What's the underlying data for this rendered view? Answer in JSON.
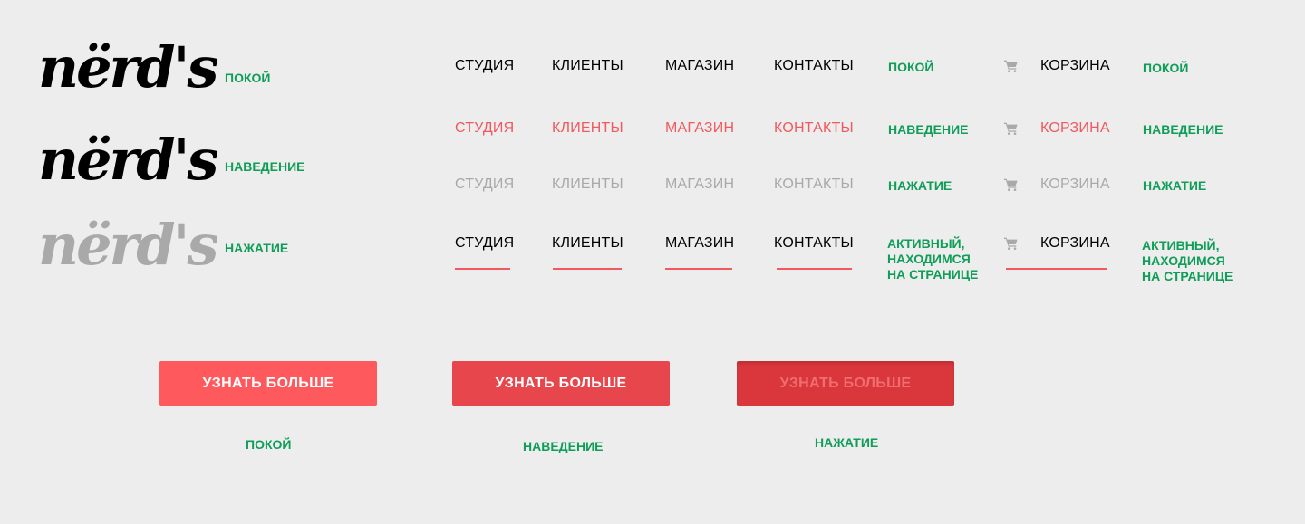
{
  "logo": {
    "text": "nërd's"
  },
  "logo_states": [
    "ПОКОЙ",
    "НАВЕДЕНИЕ",
    "НАЖАТИЕ"
  ],
  "nav": {
    "items": [
      "СТУДИЯ",
      "КЛИЕНТЫ",
      "МАГАЗИН",
      "КОНТАКТЫ"
    ],
    "cart": {
      "label": "КОРЗИНА",
      "icon": "cart-icon"
    },
    "states": {
      "normal": "ПОКОЙ",
      "hover": "НАВЕДЕНИЕ",
      "pressed": "НАЖАТИЕ",
      "active": [
        "АКТИВНЫЙ,",
        "НАХОДИМСЯ",
        "НА СТРАНИЦЕ"
      ]
    }
  },
  "button": {
    "label": "УЗНАТЬ БОЛЬШЕ",
    "states": [
      "ПОКОЙ",
      "НАВЕДЕНИЕ",
      "НАЖАТИЕ"
    ]
  },
  "colors": {
    "background": "#ededed",
    "state_label": "#0f9d58",
    "nav_normal": "#000000",
    "nav_hover": "#f0595e",
    "nav_pressed": "#a9a9a9",
    "underline": "#f0595e",
    "button_normal": "#fe5a5e",
    "button_hover": "#e6464c",
    "button_pressed": "#d9373c",
    "button_pressed_text": "#ee6e72"
  }
}
